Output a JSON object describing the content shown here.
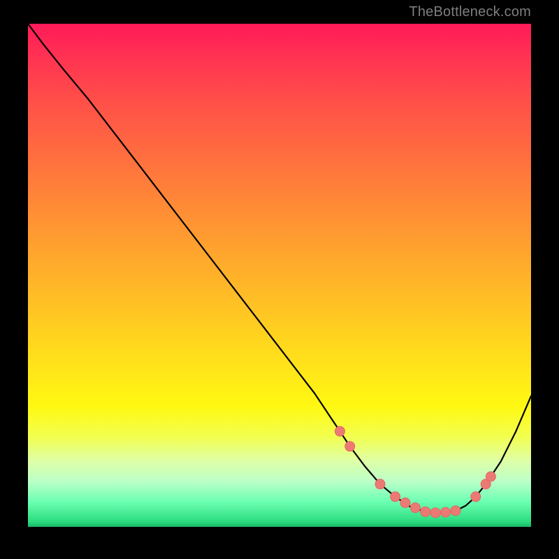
{
  "watermark": "TheBottleneck.com",
  "colors": {
    "frame": "#000000",
    "curve": "#000000",
    "markerFill": "#ec7a74",
    "markerStroke": "#e46660"
  },
  "chart_data": {
    "type": "line",
    "title": "",
    "xlabel": "",
    "ylabel": "",
    "xlim": [
      0,
      100
    ],
    "ylim": [
      0,
      100
    ],
    "grid": false,
    "series": [
      {
        "name": "bottleneck-curve",
        "x": [
          0,
          3,
          7,
          12,
          17,
          22,
          27,
          32,
          37,
          42,
          47,
          52,
          57,
          60,
          62,
          64,
          67,
          70,
          73,
          76,
          79,
          82,
          85,
          87,
          89,
          91,
          94,
          97,
          100
        ],
        "y": [
          100,
          96,
          91,
          85,
          78.5,
          72,
          65.5,
          59,
          52.5,
          46,
          39.5,
          33,
          26.5,
          22,
          19,
          16,
          12,
          8.5,
          6,
          4,
          3,
          2.8,
          3.2,
          4.2,
          6,
          8.5,
          13,
          19,
          26
        ]
      }
    ],
    "markers": {
      "name": "highlight-points",
      "x": [
        62,
        64,
        70,
        73,
        75,
        77,
        79,
        81,
        83,
        85,
        89,
        91,
        92
      ],
      "y": [
        19,
        16,
        8.5,
        6,
        4.8,
        3.8,
        3,
        2.8,
        2.9,
        3.2,
        6,
        8.5,
        10
      ]
    }
  }
}
